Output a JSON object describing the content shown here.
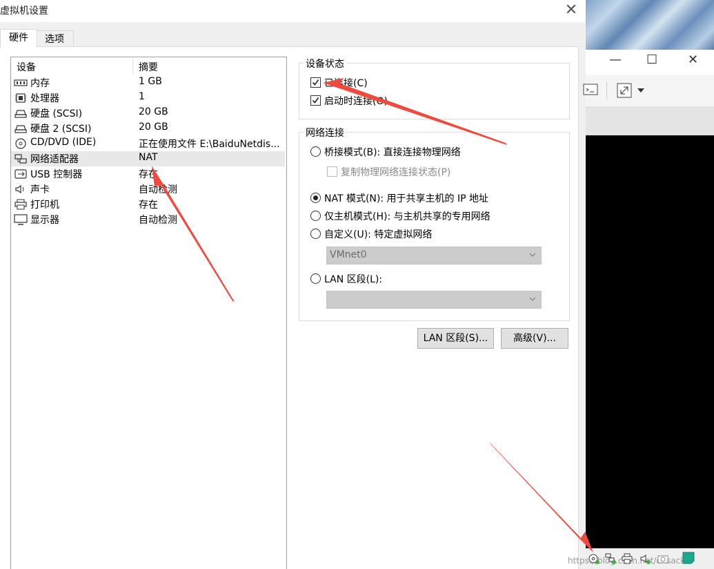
{
  "dialog": {
    "title": "虚拟机设置",
    "close_glyph": "✕",
    "tabs": [
      {
        "label": "硬件"
      },
      {
        "label": "选项"
      }
    ]
  },
  "device_list": {
    "headers": {
      "device": "设备",
      "summary": "摘要"
    },
    "rows": [
      {
        "icon": "memory-icon",
        "name": "内存",
        "summary": "1 GB"
      },
      {
        "icon": "cpu-icon",
        "name": "处理器",
        "summary": "1"
      },
      {
        "icon": "hard-disk-icon",
        "name": "硬盘 (SCSI)",
        "summary": "20 GB"
      },
      {
        "icon": "hard-disk-icon",
        "name": "硬盘 2 (SCSI)",
        "summary": "20 GB"
      },
      {
        "icon": "cd-dvd-icon",
        "name": "CD/DVD (IDE)",
        "summary": "正在使用文件 E:\\BaiduNetdis..."
      },
      {
        "icon": "network-adapter-icon",
        "name": "网络适配器",
        "summary": "NAT",
        "selected": true
      },
      {
        "icon": "usb-icon",
        "name": "USB 控制器",
        "summary": "存在"
      },
      {
        "icon": "sound-icon",
        "name": "声卡",
        "summary": "自动检测"
      },
      {
        "icon": "printer-icon",
        "name": "打印机",
        "summary": "存在"
      },
      {
        "icon": "display-icon",
        "name": "显示器",
        "summary": "自动检测"
      }
    ]
  },
  "device_status": {
    "title": "设备状态",
    "connected": {
      "label": "已连接(C)",
      "checked": true
    },
    "connect_at_power_on": {
      "label": "启动时连接(O)",
      "checked": true
    }
  },
  "network_connection": {
    "title": "网络连接",
    "bridged": {
      "label": "桥接模式(B): 直接连接物理网络",
      "selected": false
    },
    "replicate": {
      "label": "复制物理网络连接状态(P)",
      "checked": false,
      "disabled": true
    },
    "nat": {
      "label": "NAT 模式(N): 用于共享主机的 IP 地址",
      "selected": true
    },
    "host_only": {
      "label": "仅主机模式(H): 与主机共享的专用网络",
      "selected": false
    },
    "custom": {
      "label": "自定义(U): 特定虚拟网络",
      "selected": false
    },
    "custom_select": {
      "value": "VMnet0",
      "disabled": true
    },
    "lan_segment": {
      "label": "LAN 区段(L):",
      "selected": false
    },
    "lan_select": {
      "value": "",
      "disabled": true
    }
  },
  "buttons": {
    "lan_segments": "LAN 区段(S)...",
    "advanced": "高级(V)..."
  },
  "vm_window": {
    "controls": {
      "minimize": "—",
      "maximize": "☐",
      "close": "✕"
    },
    "toolbar_icons": [
      "console-icon",
      "fullscreen-icon",
      "chevron-down-icon"
    ],
    "status_icons": [
      "cd-dvd-status-icon",
      "network-status-icon",
      "printer-status-icon",
      "sound-status-icon",
      "camera-status-icon",
      "message-status-icon"
    ],
    "watermark": "https://blog.csdn.net/dxsack"
  },
  "colors": {
    "annotation_arrow": "#f04a3e",
    "status_led": "#3cb043",
    "selection": "#e8e8e8"
  }
}
